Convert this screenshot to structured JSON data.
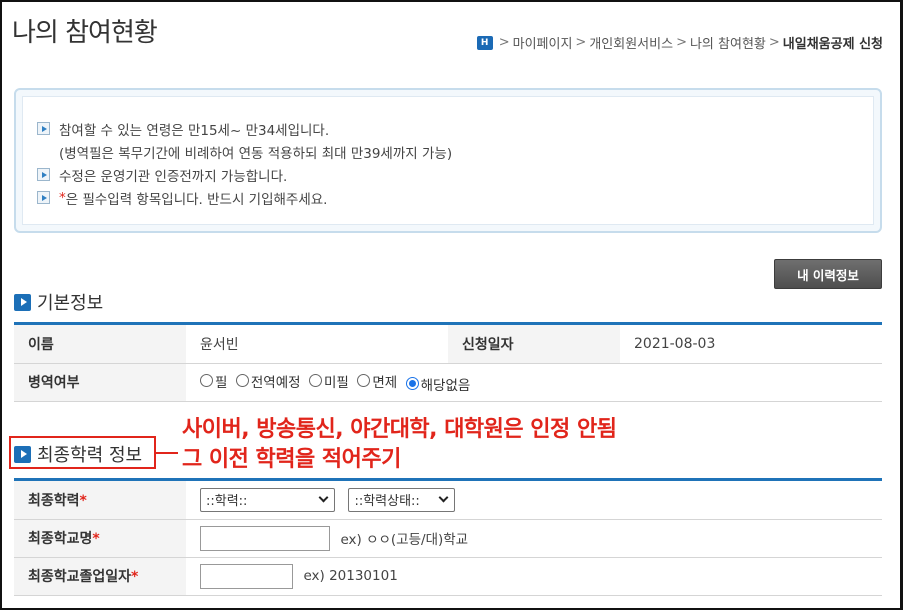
{
  "page_title": "나의 참여현황",
  "breadcrumb": {
    "home": "H",
    "items": [
      "마이페이지",
      "개인회원서비스",
      "나의 참여현황"
    ],
    "current": "내일채움공제 신청",
    "sep": ">"
  },
  "notice": {
    "line1": "참여할 수 있는 연령은 만15세~ 만34세입니다.",
    "line2": "(병역필은 복무기간에 비례하여 연동 적용하되 최대 만39세까지 가능)",
    "line3": "수정은 운영기관 인증전까지 가능합니다.",
    "line4_star": "*",
    "line4": "은 필수입력 항목입니다. 반드시 기입해주세요."
  },
  "history_button": "내 이력정보",
  "basic_section": {
    "title": "기본정보",
    "name_label": "이름",
    "name_value": "윤서빈",
    "apply_date_label": "신청일자",
    "apply_date_value": "2021-08-03",
    "military_label": "병역여부",
    "military_options": [
      "필",
      "전역예정",
      "미필",
      "면제",
      "해당없음"
    ],
    "military_selected": "해당없음"
  },
  "edu_section": {
    "title": "최종학력 정보",
    "required_mark": "*",
    "level_label": "최종학력",
    "level_select": "::학력::",
    "status_select": "::학력상태::",
    "school_label": "최종학교명",
    "school_hint": "ex) ㅇㅇ(고등/대)학교",
    "grad_label": "최종학교졸업일자",
    "grad_hint": "ex) 20130101"
  },
  "annotation": {
    "line1": "사이버, 방송통신, 야간대학, 대학원은 인정 안됨",
    "line2": "그 이전 학력을 적어주기",
    "color": "#e1251b"
  },
  "colors": {
    "accent": "#1f73b8",
    "radio_selected": "#1a73e8",
    "button": "#5a5a5a"
  }
}
